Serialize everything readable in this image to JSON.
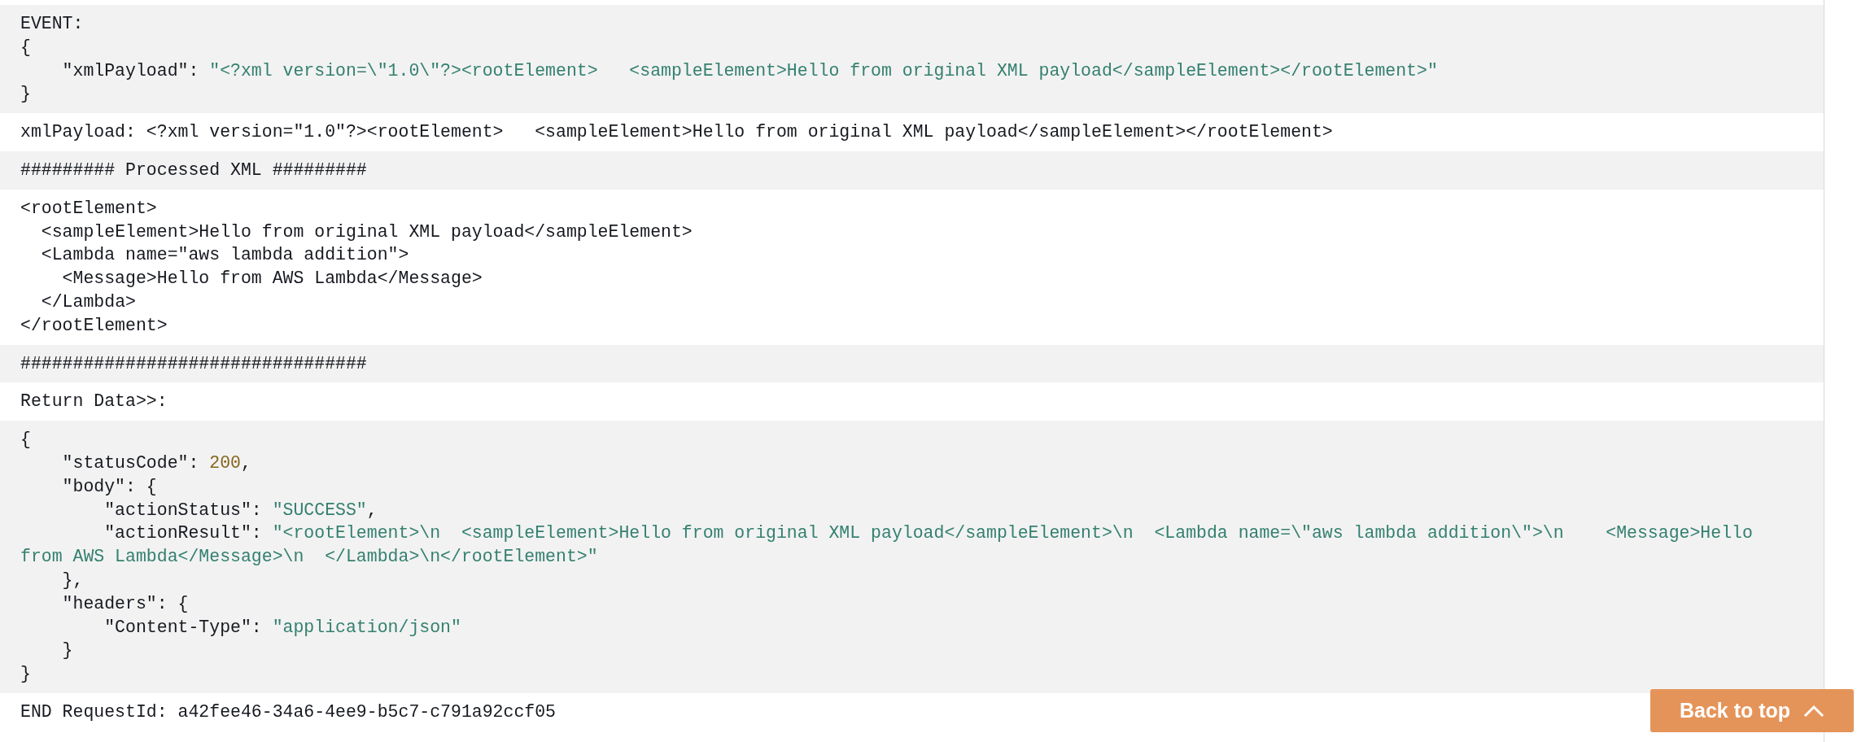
{
  "entries": [
    {
      "highlighted": true,
      "lines": [
        [
          {
            "kind": "plain",
            "text": "EVENT:"
          }
        ],
        [
          {
            "kind": "plain",
            "text": "{"
          }
        ],
        [
          {
            "kind": "plain",
            "text": "    \"xmlPayload\": "
          },
          {
            "kind": "string",
            "text": "\"<?xml version=\\\"1.0\\\"?><rootElement>   <sampleElement>Hello from original XML payload</sampleElement></rootElement>\""
          }
        ],
        [
          {
            "kind": "plain",
            "text": "}"
          }
        ]
      ]
    },
    {
      "highlighted": false,
      "lines": [
        [
          {
            "kind": "plain",
            "text": "xmlPayload: <?xml version=\"1.0\"?><rootElement>   <sampleElement>Hello from original XML payload</sampleElement></rootElement>"
          }
        ]
      ]
    },
    {
      "highlighted": true,
      "lines": [
        [
          {
            "kind": "plain",
            "text": "######### Processed XML #########"
          }
        ]
      ]
    },
    {
      "highlighted": false,
      "lines": [
        [
          {
            "kind": "plain",
            "text": "<rootElement>"
          }
        ],
        [
          {
            "kind": "plain",
            "text": "  <sampleElement>Hello from original XML payload</sampleElement>"
          }
        ],
        [
          {
            "kind": "plain",
            "text": "  <Lambda name=\"aws lambda addition\">"
          }
        ],
        [
          {
            "kind": "plain",
            "text": "    <Message>Hello from AWS Lambda</Message>"
          }
        ],
        [
          {
            "kind": "plain",
            "text": "  </Lambda>"
          }
        ],
        [
          {
            "kind": "plain",
            "text": "</rootElement>"
          }
        ]
      ]
    },
    {
      "highlighted": true,
      "lines": [
        [
          {
            "kind": "plain",
            "text": "#################################"
          }
        ]
      ]
    },
    {
      "highlighted": false,
      "lines": [
        [
          {
            "kind": "plain",
            "text": "Return Data>>:"
          }
        ]
      ]
    },
    {
      "highlighted": true,
      "lines": [
        [
          {
            "kind": "plain",
            "text": "{"
          }
        ],
        [
          {
            "kind": "plain",
            "text": "    \"statusCode\": "
          },
          {
            "kind": "number",
            "text": "200"
          },
          {
            "kind": "plain",
            "text": ","
          }
        ],
        [
          {
            "kind": "plain",
            "text": "    \"body\": {"
          }
        ],
        [
          {
            "kind": "plain",
            "text": "        \"actionStatus\": "
          },
          {
            "kind": "string",
            "text": "\"SUCCESS\""
          },
          {
            "kind": "plain",
            "text": ","
          }
        ],
        [
          {
            "kind": "plain",
            "text": "        \"actionResult\": "
          },
          {
            "kind": "string",
            "text": "\"<rootElement>\\n  <sampleElement>Hello from original XML payload</sampleElement>\\n  <Lambda name=\\\"aws lambda addition\\\">\\n    <Message>Hello from AWS Lambda</Message>\\n  </Lambda>\\n</rootElement>\""
          }
        ],
        [
          {
            "kind": "plain",
            "text": "    },"
          }
        ],
        [
          {
            "kind": "plain",
            "text": "    \"headers\": {"
          }
        ],
        [
          {
            "kind": "plain",
            "text": "        \"Content-Type\": "
          },
          {
            "kind": "string",
            "text": "\"application/json\""
          }
        ],
        [
          {
            "kind": "plain",
            "text": "    }"
          }
        ],
        [
          {
            "kind": "plain",
            "text": "}"
          }
        ]
      ]
    },
    {
      "highlighted": false,
      "lines": [
        [
          {
            "kind": "plain",
            "text": "END RequestId: a42fee46-34a6-4ee9-b5c7-c791a92ccf05"
          }
        ]
      ]
    }
  ],
  "back_to_top": {
    "label": "Back to top"
  }
}
